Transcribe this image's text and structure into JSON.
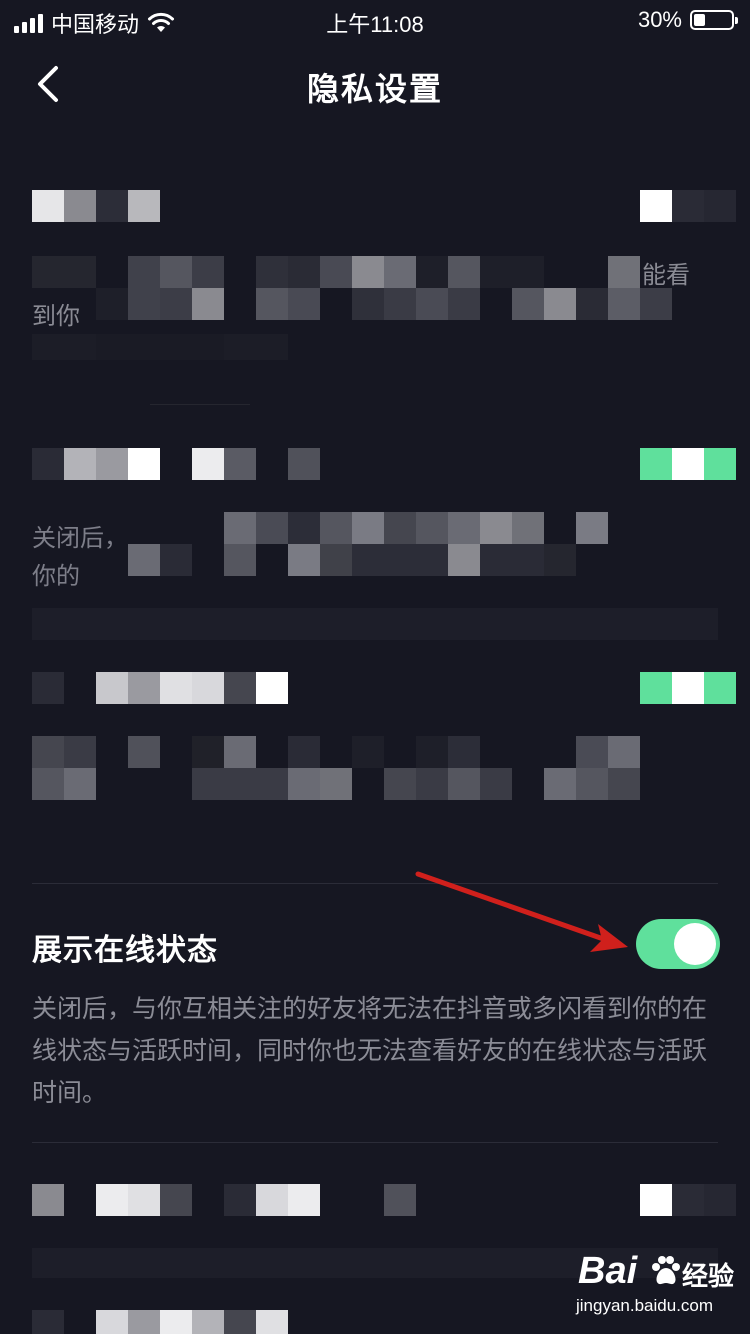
{
  "status_bar": {
    "carrier": "中国移动",
    "time": "上午11:08",
    "battery_percent": "30%",
    "battery_level": 0.3
  },
  "nav": {
    "title": "隐私设置"
  },
  "sections": {
    "section1_fragment_right": "能看",
    "section1_fragment_left": "到你",
    "section2_fragment1": "关闭后，",
    "section2_fragment2": "你的"
  },
  "online_status": {
    "title": "展示在线状态",
    "description": "关闭后，与你互相关注的好友将无法在抖音或多闪看到你的在线状态与活跃时间，同时你也无法查看好友的在线状态与活跃时间。",
    "enabled": true
  },
  "watermark": {
    "brand": "Bai",
    "brand_suffix": "经验",
    "url": "jingyan.baidu.com"
  },
  "colors": {
    "background": "#161722",
    "toggle_on": "#5fe09c",
    "annotation_arrow": "#d0201c"
  }
}
